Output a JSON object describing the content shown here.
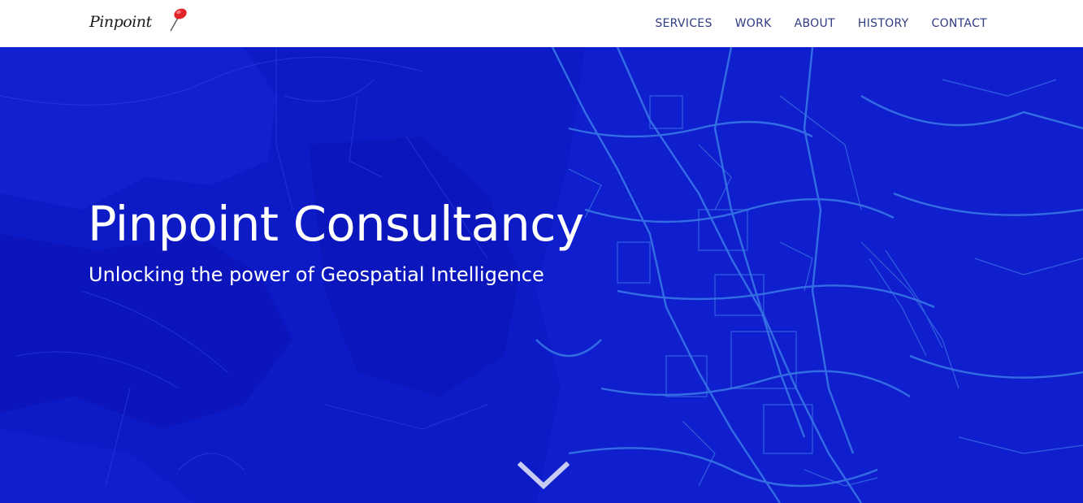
{
  "brand": {
    "logo_text": "Pinpoint",
    "logo_icon": "red-pushpin-icon"
  },
  "nav": {
    "items": [
      {
        "label": "SERVICES"
      },
      {
        "label": "WORK"
      },
      {
        "label": "ABOUT"
      },
      {
        "label": "HISTORY"
      },
      {
        "label": "CONTACT"
      }
    ]
  },
  "hero": {
    "title": "Pinpoint Consultancy",
    "subtitle": "Unlocking the power of Geospatial Intelligence",
    "background_icon": "street-map-background",
    "scroll_icon": "chevron-down-icon"
  },
  "colors": {
    "hero_blue": "#0d1bc7",
    "map_roads": "#3a7be8",
    "nav_text": "#2f3b82",
    "pin_red": "#e0242a"
  }
}
